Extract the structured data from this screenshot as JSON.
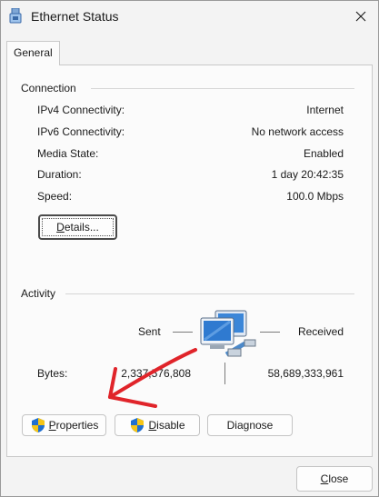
{
  "window": {
    "title": "Ethernet Status",
    "close_icon": "close-icon"
  },
  "tabs": [
    {
      "label": "General",
      "selected": true
    }
  ],
  "connection": {
    "group_label": "Connection",
    "rows": [
      {
        "label": "IPv4 Connectivity:",
        "value": "Internet"
      },
      {
        "label": "IPv6 Connectivity:",
        "value": "No network access"
      },
      {
        "label": "Media State:",
        "value": "Enabled"
      },
      {
        "label": "Duration:",
        "value": "1 day 20:42:35"
      },
      {
        "label": "Speed:",
        "value": "100.0 Mbps"
      }
    ],
    "details_button": {
      "first": "D",
      "rest": "etails..."
    }
  },
  "activity": {
    "group_label": "Activity",
    "sent_label": "Sent",
    "received_label": "Received",
    "bytes_label": "Bytes:",
    "bytes_sent": "2,337,576,808",
    "bytes_received": "58,689,333,961"
  },
  "buttons": {
    "properties": {
      "first": "P",
      "rest": "roperties"
    },
    "disable": {
      "first": "D",
      "rest": "isable"
    },
    "diagnose": {
      "label": "Diagnose"
    },
    "close": {
      "first": "C",
      "rest": "lose"
    }
  },
  "colors": {
    "annotation_arrow": "#e0242a",
    "shield_blue": "#1f6fd1",
    "shield_yellow": "#f5c518"
  }
}
